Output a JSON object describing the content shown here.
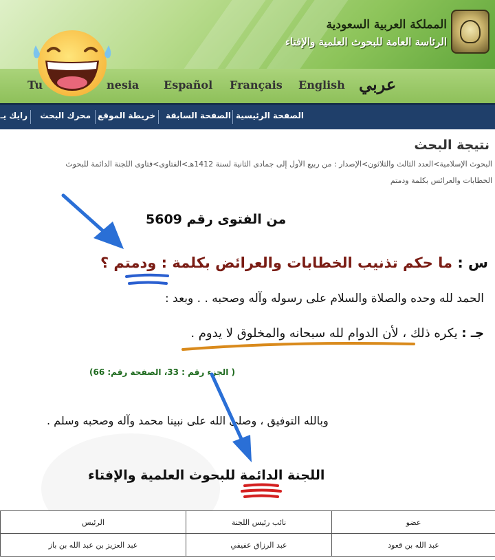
{
  "header": {
    "kingdom": "المملكة العربية السعودية",
    "presidency": "الرئاسة العامة للبحوث العلمية والإفتاء",
    "logo_icon": "emblem-icon",
    "emoji_icon": "laughing-emoji-icon"
  },
  "languages": [
    "Tu",
    "nesia",
    "Español",
    "Français",
    "English",
    "عربي"
  ],
  "nav": {
    "items": [
      "الصفحة الرئيسية",
      "الصفحة السابقة",
      "خريطة الموقع",
      "محرك البحث",
      "رايك يـ"
    ]
  },
  "page": {
    "title": "نتيجة البحث",
    "breadcrumb_line1": "البحوث الإسلامية>العدد الثالث والثلاثون>الإصدار : من ربيع الأول إلى جمادى الثانية لسنة 1412هـ>الفتاوى>فتاوى اللجنة الدائمة للبحوث",
    "breadcrumb_line2": "الخطابات والعرائس بكلمة ودمتم"
  },
  "fatwa": {
    "number_line": "من الفتوى رقم 5609",
    "question_label": "س :",
    "question_text": "ما حكم تذنيب الخطابات والعرائض بكلمة :",
    "question_keyword": "ودمتم ؟",
    "praise": "الحمد لله وحده والصلاة والسلام على رسوله وآله وصحبه . . وبعد :",
    "answer_label": "جـ :",
    "answer_text": "يكره ذلك ، لأن الدوام لله سبحانه والمخلوق لا يدوم .",
    "reference": "( الجزء رقم : 33، الصفحة رقم: 66)",
    "closing": "وبالله التوفيق ، وصلى الله على نبينا محمد وآله وصحبه وسلم .",
    "committee": "اللجنة الدائمة للبحوث العلمية والإفتاء"
  },
  "signatories": {
    "headers": [
      "عضو",
      "نائب رئيس اللجنة",
      "الرئيس"
    ],
    "names": [
      "عبد الله بن قعود",
      "عبد الرزاق عفيفي",
      "عبد العزيز بن عبد الله بن باز"
    ]
  },
  "annotation_colors": {
    "arrow": "#2a6fd6",
    "blue_underline": "#2a5fd0",
    "orange_underline": "#d98a1c",
    "red_underline": "#d42020",
    "header_green": "#8dc45a",
    "nav_blue": "#1f3f6a"
  }
}
